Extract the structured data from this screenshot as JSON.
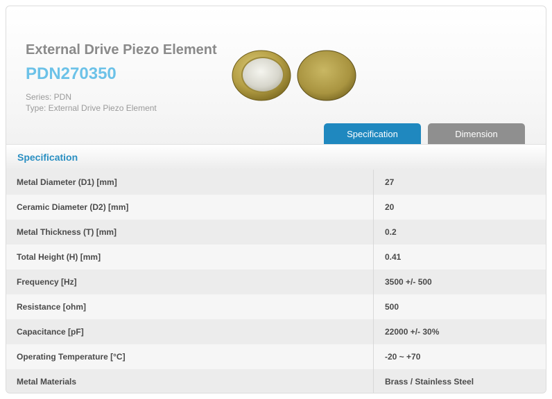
{
  "product": {
    "title": "External Drive Piezo Element",
    "model": "PDN270350",
    "series_text": "Series: PDN",
    "type_text": "Type: External Drive Piezo Element"
  },
  "images": {
    "front": "piezo-disc-front-icon",
    "back": "piezo-disc-back-icon"
  },
  "tabs": [
    {
      "label": "Specification",
      "active": true
    },
    {
      "label": "Dimension",
      "active": false
    }
  ],
  "spec": {
    "header": "Specification",
    "rows": [
      {
        "label": "Metal Diameter (D1) [mm]",
        "value": "27"
      },
      {
        "label": "Ceramic Diameter (D2) [mm]",
        "value": "20"
      },
      {
        "label": "Metal Thickness (T) [mm]",
        "value": "0.2"
      },
      {
        "label": "Total Height (H) [mm]",
        "value": "0.41"
      },
      {
        "label": "Frequency [Hz]",
        "value": "3500 +/- 500"
      },
      {
        "label": "Resistance [ohm]",
        "value": "500"
      },
      {
        "label": "Capacitance [pF]",
        "value": "22000 +/- 30%"
      },
      {
        "label": "Operating Temperature [°C]",
        "value": "-20 ~ +70"
      },
      {
        "label": "Metal Materials",
        "value": "Brass / Stainless Steel"
      }
    ]
  },
  "colors": {
    "accent": "#1f88bf",
    "model_text": "#6cc2e8",
    "inactive_tab": "#8f8f8f",
    "brass": "#b8a64a"
  }
}
